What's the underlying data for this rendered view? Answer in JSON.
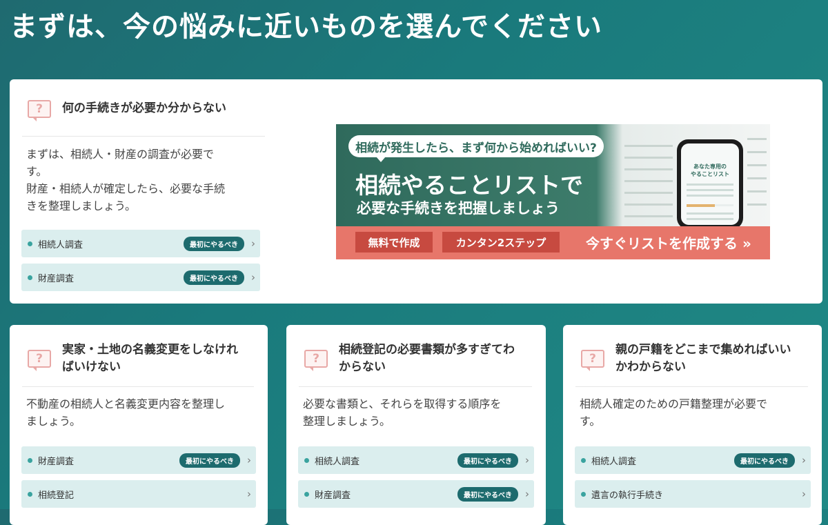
{
  "page": {
    "title": "まずは、今の悩みに近いものを選んでください"
  },
  "task_badge": "最初にやるべき",
  "cards": [
    {
      "question": "何の手続きが必要か分からない",
      "desc_lines": [
        "まずは、相続人・財産の調査が必要で",
        "す。",
        "財産・相続人が確定したら、必要な手続",
        "きを整理しましょう。"
      ],
      "tasks": [
        {
          "label": "相続人調査",
          "badge": true
        },
        {
          "label": "財産調査",
          "badge": true
        }
      ]
    },
    {
      "question_lines": [
        "実家・土地の名義変更をしなけれ",
        "ばいけない"
      ],
      "desc_lines": [
        "不動産の相続人と名義変更内容を整理し",
        "ましょう。"
      ],
      "tasks": [
        {
          "label": "財産調査",
          "badge": true
        },
        {
          "label": "相続登記",
          "badge": false
        }
      ]
    },
    {
      "question_lines": [
        "相続登記の必要書類が多すぎてわ",
        "からない"
      ],
      "desc_lines": [
        "必要な書類と、それらを取得する順序を",
        "整理しましょう。"
      ],
      "tasks": [
        {
          "label": "相続人調査",
          "badge": true
        },
        {
          "label": "財産調査",
          "badge": true
        }
      ]
    },
    {
      "question_lines": [
        "親の戸籍をどこまで集めればいい",
        "かわからない"
      ],
      "desc_lines": [
        "相続人確定のための戸籍整理が必要で",
        "す。"
      ],
      "tasks": [
        {
          "label": "相続人調査",
          "badge": true
        },
        {
          "label": "遺言の執行手続き",
          "badge": false
        }
      ]
    }
  ],
  "banner": {
    "question": "相続が発生したら、まず何から始めればいい?",
    "headline": "相続やることリストで",
    "subhead": "必要な手続きを把握しましょう",
    "pill_free": "無料で作成",
    "pill_steps": "カンタン2ステップ",
    "cta": "今すぐリストを作成する »",
    "phone_title_lines": [
      "あなた専用の",
      "やることリスト"
    ],
    "phone_progress": 0.6
  },
  "icons": {
    "question": "question-bubble-icon",
    "chevron": "chevron-right-icon"
  },
  "colors": {
    "accent": "#1d6b6e",
    "banner_red": "#e7766a",
    "task_bg": "#dbeeee",
    "question_icon": "#e8a8a6"
  }
}
